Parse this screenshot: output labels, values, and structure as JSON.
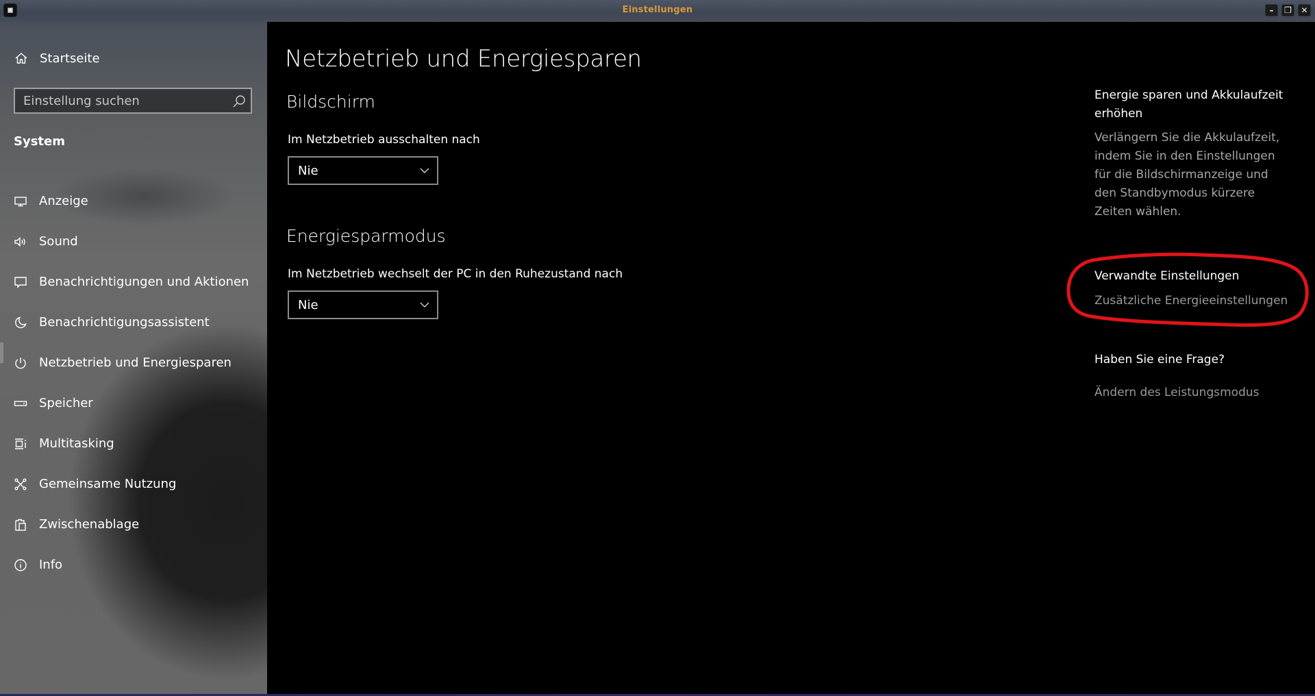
{
  "window": {
    "title": "Einstellungen",
    "controls": {
      "minimize": "–",
      "restore": "❐",
      "close": "✕"
    }
  },
  "sidebar": {
    "home_label": "Startseite",
    "home_icon": "home-icon",
    "search": {
      "placeholder": "Einstellung suchen",
      "value": "",
      "icon": "search-icon"
    },
    "section_label": "System",
    "items": [
      {
        "label": "Anzeige",
        "icon": "monitor-icon",
        "selected": false
      },
      {
        "label": "Sound",
        "icon": "speaker-icon",
        "selected": false
      },
      {
        "label": "Benachrichtigungen und Aktionen",
        "icon": "message-icon",
        "selected": false
      },
      {
        "label": "Benachrichtigungsassistent",
        "icon": "moon-icon",
        "selected": false
      },
      {
        "label": "Netzbetrieb und Energiesparen",
        "icon": "power-icon",
        "selected": true
      },
      {
        "label": "Speicher",
        "icon": "storage-icon",
        "selected": false
      },
      {
        "label": "Multitasking",
        "icon": "multitasking-icon",
        "selected": false
      },
      {
        "label": "Gemeinsame Nutzung",
        "icon": "share-icon",
        "selected": false
      },
      {
        "label": "Zwischenablage",
        "icon": "clipboard-icon",
        "selected": false
      },
      {
        "label": "Info",
        "icon": "info-icon",
        "selected": false
      }
    ]
  },
  "main": {
    "page_title": "Netzbetrieb und Energiesparen",
    "sections": [
      {
        "heading": "Bildschirm",
        "field_label": "Im Netzbetrieb ausschalten nach",
        "dropdown_value": "Nie"
      },
      {
        "heading": "Energiesparmodus",
        "field_label": "Im Netzbetrieb wechselt der PC in den Ruhezustand nach",
        "dropdown_value": "Nie"
      }
    ]
  },
  "aside": {
    "tip_heading": "Energie sparen und Akkulaufzeit erhöhen",
    "tip_text": "Verlängern Sie die Akkulaufzeit, indem Sie in den Einstellungen für die Bildschirmanzeige und den Standbymodus kürzere Zeiten wählen.",
    "related_heading": "Verwandte Einstellungen",
    "related_link": "Zusätzliche Energieeinstellungen",
    "question_heading": "Haben Sie eine Frage?",
    "question_link": "Ändern des Leistungsmodus"
  },
  "annotation": {
    "type": "hand-drawn-ellipse",
    "color": "#e0141a",
    "target": "related-settings"
  },
  "colors": {
    "title_text": "#d79a3c",
    "annotation_red": "#e0141a",
    "secondary_text": "#a6a6a6"
  }
}
